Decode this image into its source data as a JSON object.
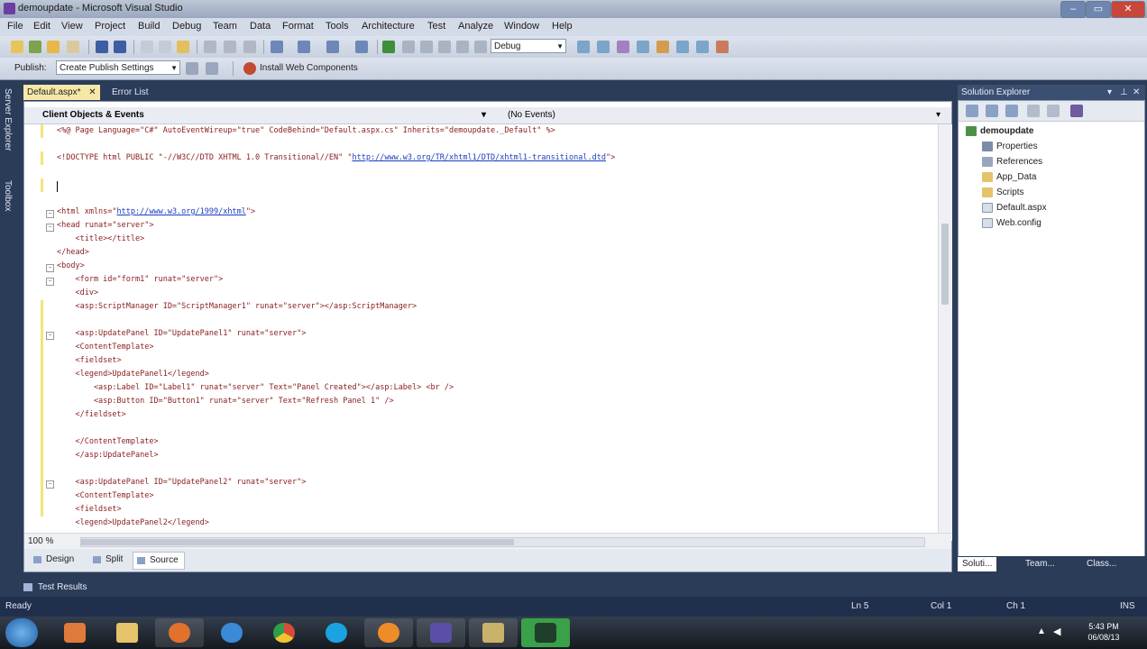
{
  "window": {
    "title": "demoupdate - Microsoft Visual Studio",
    "controls": [
      "–",
      "▭",
      "✕"
    ]
  },
  "menu": [
    "File",
    "Edit",
    "View",
    "Project",
    "Build",
    "Debug",
    "Team",
    "Data",
    "Format",
    "Tools",
    "Architecture",
    "Test",
    "Analyze",
    "Window",
    "Help"
  ],
  "toolbar1": {
    "configuration": "Debug"
  },
  "toolbar2": {
    "publish_label": "Publish:",
    "publish_settings": "Create Publish Settings",
    "install_label": "Install Web Components"
  },
  "left_strip": {
    "tabs": [
      "Server Explorer",
      "Toolbox"
    ]
  },
  "editor": {
    "tabs": [
      {
        "label": "Default.aspx*",
        "active": true
      },
      {
        "label": "Error List",
        "active": false
      }
    ],
    "nav_left": "Client Objects & Events",
    "nav_right": "(No Events)",
    "zoom": "100 %",
    "lines": [
      "<%@ Page Language=\"C#\" AutoEventWireup=\"true\" CodeBehind=\"Default.aspx.cs\" Inherits=\"demoupdate._Default\" %>",
      "",
      "<!DOCTYPE html PUBLIC \"-//W3C//DTD XHTML 1.0 Transitional//EN\" \"http://www.w3.org/TR/xhtml1/DTD/xhtml1-transitional.dtd\">",
      "",
      "",
      "",
      "<html xmlns=\"http://www.w3.org/1999/xhtml\">",
      "<head runat=\"server\">",
      "    <title></title>",
      "</head>",
      "<body>",
      "    <form id=\"form1\" runat=\"server\">",
      "    <div>",
      "    <asp:ScriptManager ID=\"ScriptManager1\" runat=\"server\"></asp:ScriptManager>",
      "",
      "    <asp:UpdatePanel ID=\"UpdatePanel1\" runat=\"server\">",
      "    <ContentTemplate>",
      "    <fieldset>",
      "    <legend>UpdatePanel1</legend>",
      "        <asp:Label ID=\"Label1\" runat=\"server\" Text=\"Panel Created\"></asp:Label> <br />",
      "        <asp:Button ID=\"Button1\" runat=\"server\" Text=\"Refresh Panel 1\" />",
      "    </fieldset>",
      "",
      "    </ContentTemplate>",
      "    </asp:UpdatePanel>",
      "",
      "    <asp:UpdatePanel ID=\"UpdatePanel2\" runat=\"server\">",
      "    <ContentTemplate>",
      "    <fieldset>",
      "    <legend>UpdatePanel2</legend>"
    ],
    "view_tabs": [
      "Design",
      "Split",
      "Source"
    ]
  },
  "solution_explorer": {
    "title": "Solution Explorer",
    "project": "demoupdate",
    "items": [
      "Properties",
      "References",
      "App_Data",
      "Scripts",
      "Default.aspx",
      "Web.config"
    ],
    "bottom_tabs": [
      "Soluti...",
      "Team...",
      "Class..."
    ]
  },
  "bottom": {
    "test_results": "Test Results",
    "status": "Ready",
    "ln": "Ln 5",
    "col": "Col 1",
    "ch": "Ch 1",
    "ins": "INS"
  },
  "taskbar": {
    "time": "5:43 PM",
    "date": "06/08/13"
  },
  "colors": {
    "ide_background": "#2b3c59",
    "line_marker": "#f3e47a",
    "tag_text": "#8b2020",
    "link_text": "#1a3cc0"
  }
}
